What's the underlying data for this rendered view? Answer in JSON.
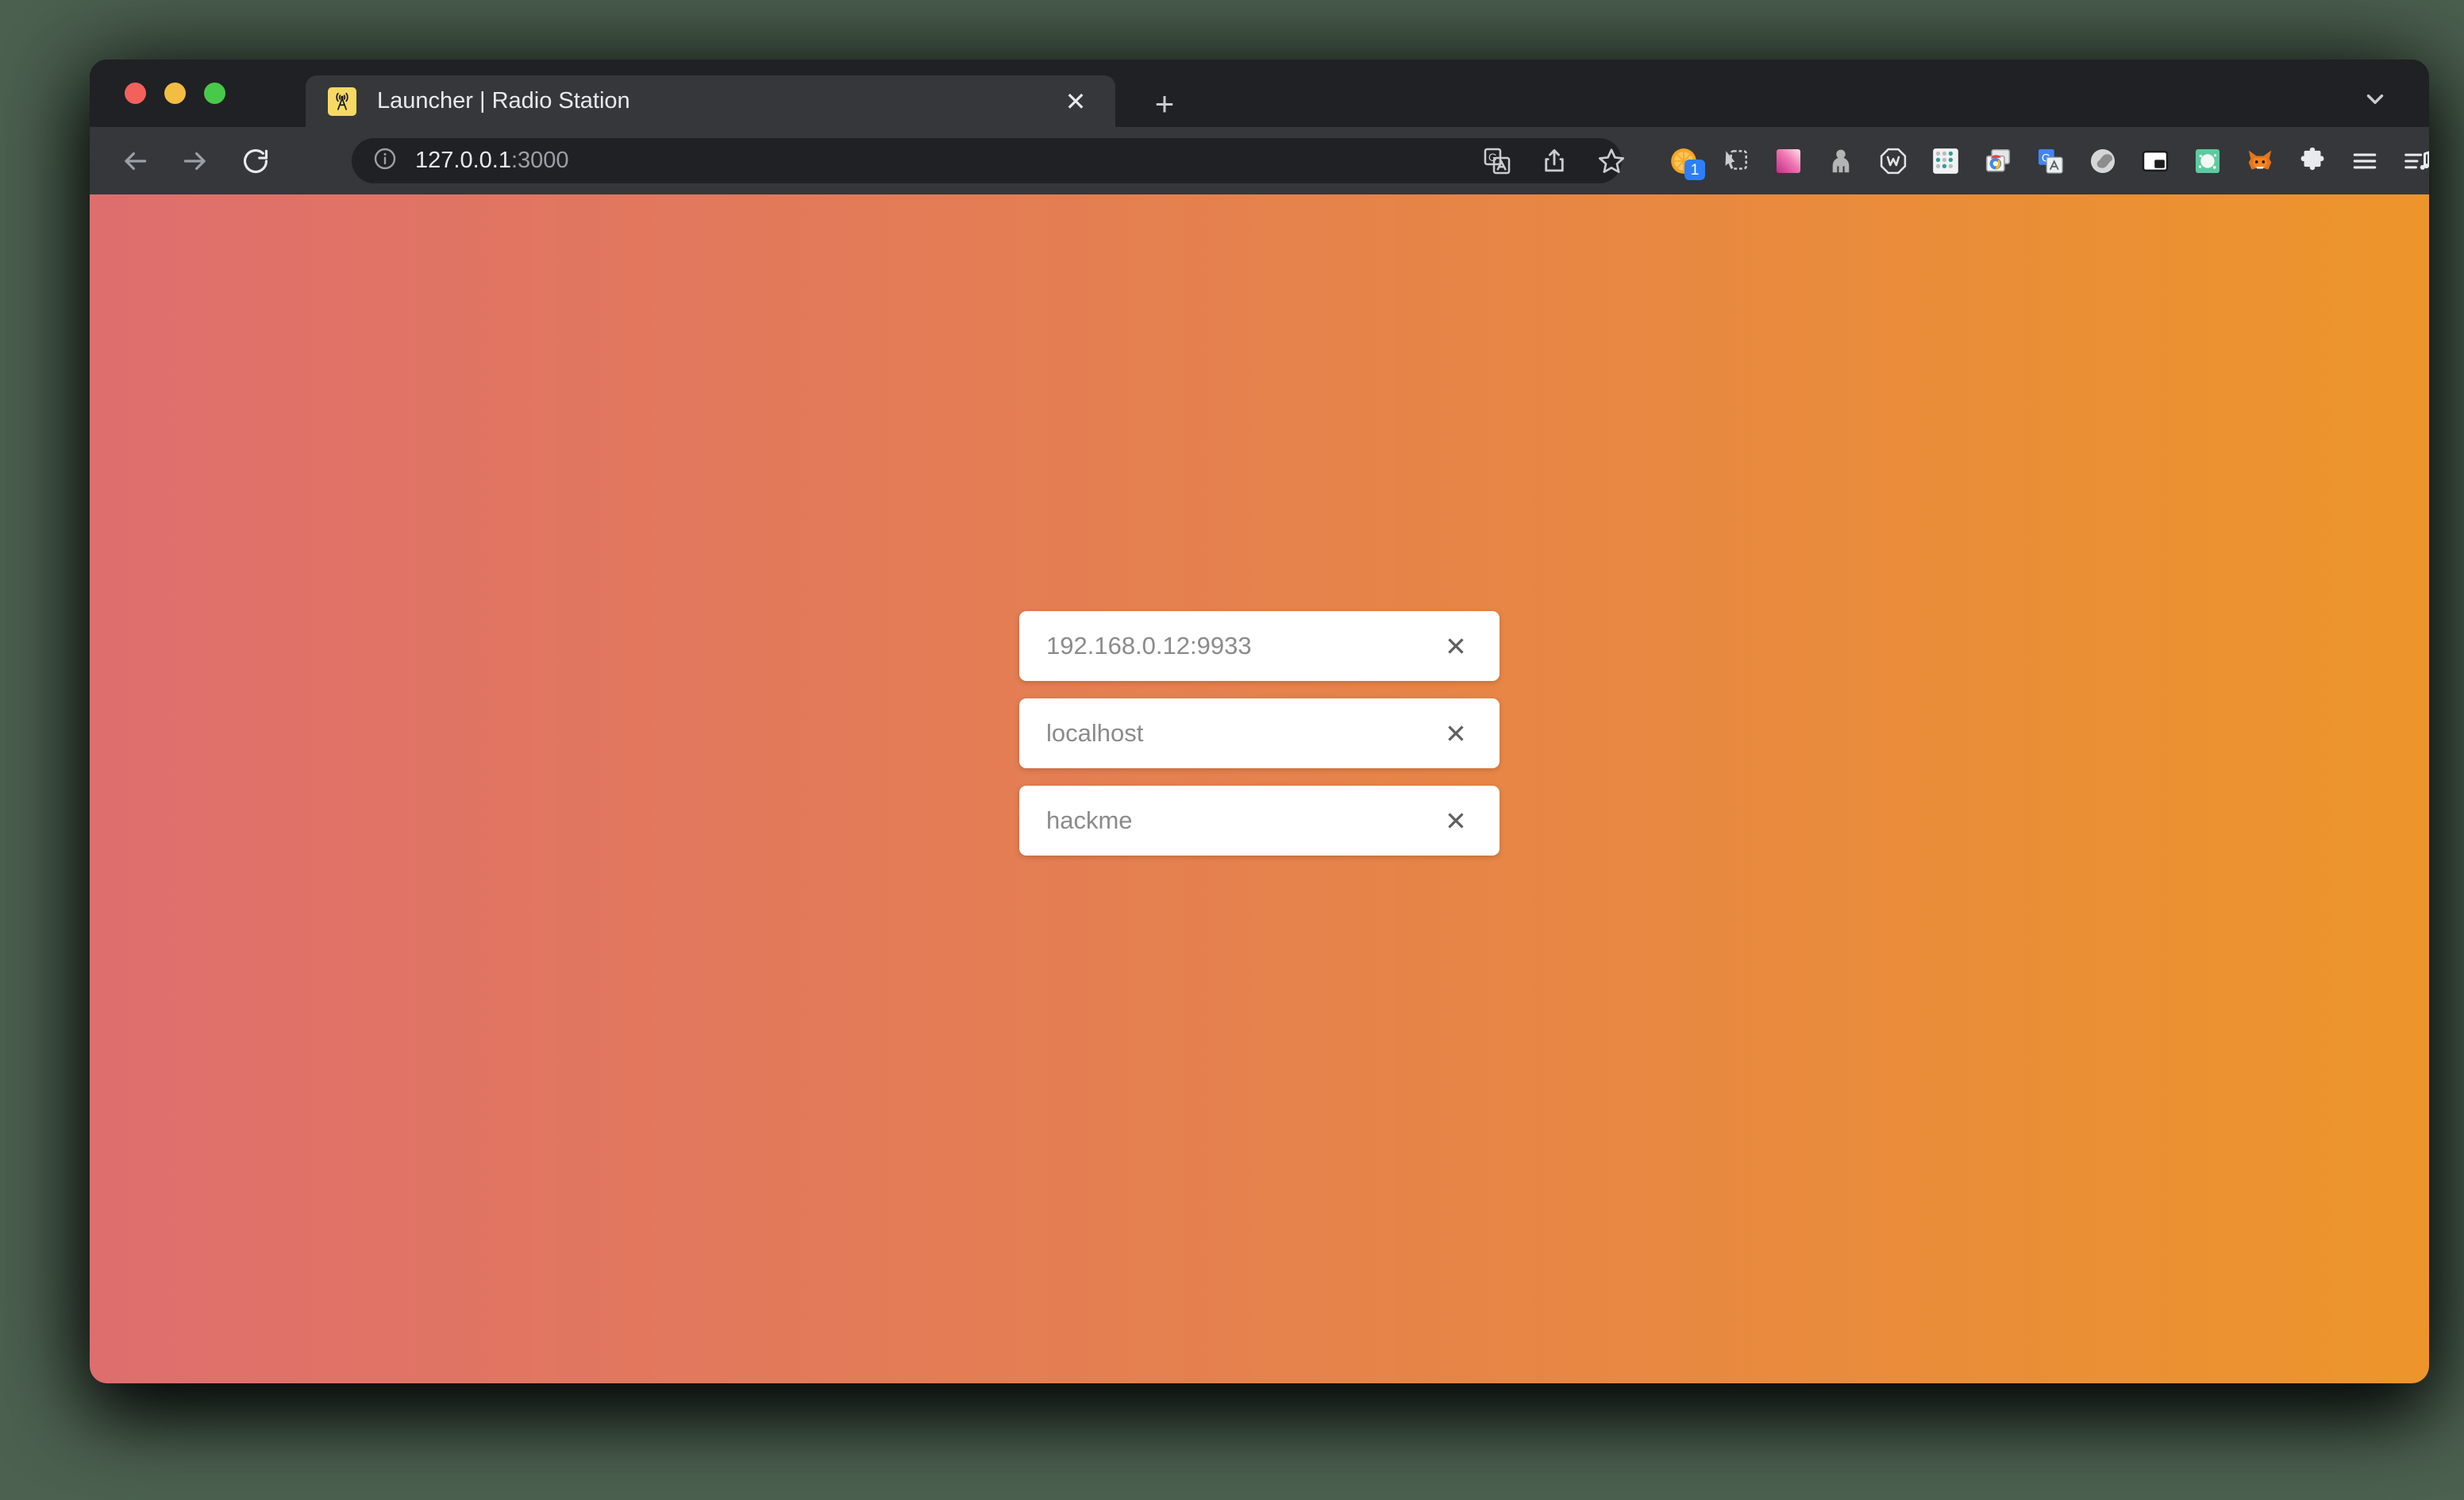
{
  "browser": {
    "traffic_lights": [
      "close",
      "minimize",
      "maximize"
    ],
    "tab": {
      "title": "Launcher | Radio Station",
      "favicon_name": "radio-tower-icon",
      "close_label": "✕"
    },
    "new_tab_label": "+",
    "tab_search_name": "chevron-down-icon",
    "nav": {
      "back_name": "back-arrow-icon",
      "forward_name": "forward-arrow-icon",
      "reload_name": "reload-icon"
    },
    "omnibox": {
      "info_name": "info-icon",
      "url_host": "127.0.0.1",
      "url_port": ":3000"
    },
    "omnibox_actions": [
      {
        "name": "translate-icon"
      },
      {
        "name": "share-icon"
      },
      {
        "name": "bookmark-star-icon"
      }
    ],
    "extensions": [
      {
        "name": "orange-slice-icon",
        "badge": "1"
      },
      {
        "name": "cursor-select-icon",
        "badge": ""
      },
      {
        "name": "pink-gradient-icon",
        "badge": ""
      },
      {
        "name": "gray-person-icon",
        "badge": ""
      },
      {
        "name": "w-octagon-icon",
        "badge": ""
      },
      {
        "name": "dot-grid-icon",
        "badge": ""
      },
      {
        "name": "chrome-windows-icon",
        "badge": ""
      },
      {
        "name": "google-translate-icon",
        "badge": ""
      },
      {
        "name": "similarweb-swirl-icon",
        "badge": ""
      },
      {
        "name": "picture-in-picture-icon",
        "badge": ""
      },
      {
        "name": "green-splash-icon",
        "badge": ""
      },
      {
        "name": "metamask-fox-icon",
        "badge": ""
      },
      {
        "name": "puzzle-piece-icon",
        "badge": ""
      },
      {
        "name": "hamburger-menu-icon",
        "badge": ""
      },
      {
        "name": "music-playlist-icon",
        "badge": ""
      }
    ],
    "profile_avatar_name": "profile-avatar-chemical-icon",
    "menu_name": "chrome-menu-icon"
  },
  "page": {
    "gradient_from": "#de6e6e",
    "gradient_to": "#ed952b",
    "fields": [
      {
        "name": "node-address-field",
        "value": "192.168.0.12:9933",
        "clear_label": "✕"
      },
      {
        "name": "hostname-field",
        "value": "localhost",
        "clear_label": "✕"
      },
      {
        "name": "password-field",
        "value": "hackme",
        "clear_label": "✕"
      }
    ]
  }
}
